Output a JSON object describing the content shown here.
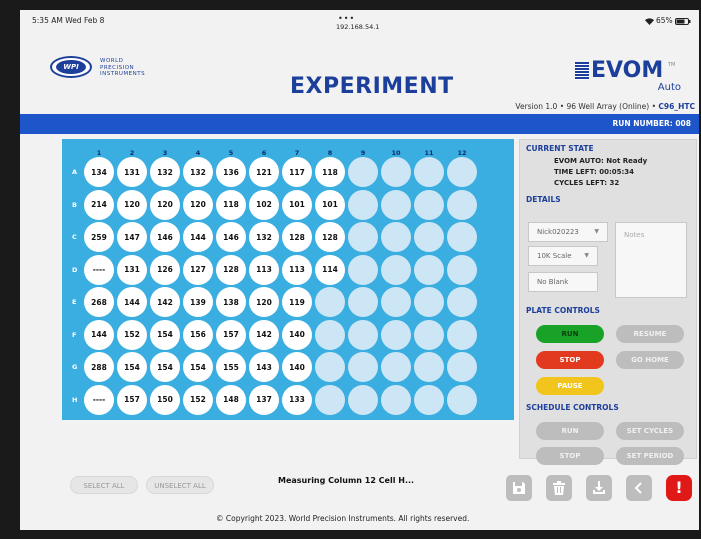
{
  "status_bar": {
    "time": "5:35 AM  Wed Feb 8",
    "dots": "•••",
    "ip": "192.168.54.1",
    "battery": "65%"
  },
  "header": {
    "company_lines": [
      "WORLD",
      "PRECISION",
      "INSTRUMENTS"
    ],
    "logo_text": "WPI",
    "title": "EXPERIMENT",
    "brand": "EVOM",
    "brand_tm": "TM",
    "brand_sub": "Auto",
    "version_prefix": "Version 1.0 • 96 Well Array (Online) • ",
    "version_protocol": "C96_HTC",
    "run_number": "RUN NUMBER: 008"
  },
  "plate": {
    "columns": [
      "1",
      "2",
      "3",
      "4",
      "5",
      "6",
      "7",
      "8",
      "9",
      "10",
      "11",
      "12"
    ],
    "rows": [
      {
        "label": "A",
        "values": [
          "134",
          "131",
          "132",
          "132",
          "136",
          "121",
          "117",
          "118"
        ]
      },
      {
        "label": "B",
        "values": [
          "214",
          "120",
          "120",
          "120",
          "118",
          "102",
          "101",
          "101"
        ]
      },
      {
        "label": "C",
        "values": [
          "259",
          "147",
          "146",
          "144",
          "146",
          "132",
          "128",
          "128"
        ]
      },
      {
        "label": "D",
        "values": [
          "----",
          "131",
          "126",
          "127",
          "128",
          "113",
          "113",
          "114"
        ]
      },
      {
        "label": "E",
        "values": [
          "268",
          "144",
          "142",
          "139",
          "138",
          "120",
          "119"
        ]
      },
      {
        "label": "F",
        "values": [
          "144",
          "152",
          "154",
          "156",
          "157",
          "142",
          "140"
        ]
      },
      {
        "label": "G",
        "values": [
          "288",
          "154",
          "154",
          "154",
          "155",
          "143",
          "140"
        ]
      },
      {
        "label": "H",
        "values": [
          "----",
          "157",
          "150",
          "152",
          "148",
          "137",
          "133"
        ]
      }
    ]
  },
  "current_state": {
    "title": "CURRENT STATE",
    "evom_auto": "EVOM AUTO: Not Ready",
    "time_left": "TIME LEFT: 00:05:34",
    "cycles_left": "CYCLES LEFT: 32"
  },
  "details": {
    "title": "DETAILS",
    "user": "Nick020223",
    "scale": "10K Scale",
    "blank": "No Blank",
    "notes_placeholder": "Notes"
  },
  "plate_controls": {
    "title": "PLATE CONTROLS",
    "run": "RUN",
    "resume": "RESUME",
    "stop": "STOP",
    "go_home": "GO HOME",
    "pause": "PAUSE"
  },
  "schedule_controls": {
    "title": "SCHEDULE CONTROLS",
    "run": "RUN",
    "set_cycles": "SET CYCLES",
    "stop": "STOP",
    "set_period": "SET PERIOD"
  },
  "footer": {
    "select_all": "SELECT ALL",
    "unselect_all": "UNSELECT ALL",
    "status_message": "Measuring Column 12 Cell H...",
    "alert": "!",
    "copyright": "© Copyright 2023. World Precision Instruments. All rights reserved."
  },
  "colors": {
    "brand_blue": "#1c3f9b",
    "band_blue": "#1e55c8",
    "plate_blue": "#3aaee0",
    "run_green": "#18a228",
    "stop_red": "#e23a1e",
    "pause_yellow": "#f2c51d"
  },
  "icons": [
    "wifi-icon",
    "battery-icon",
    "save-icon",
    "trash-icon",
    "download-icon",
    "back-icon",
    "alert-icon"
  ]
}
